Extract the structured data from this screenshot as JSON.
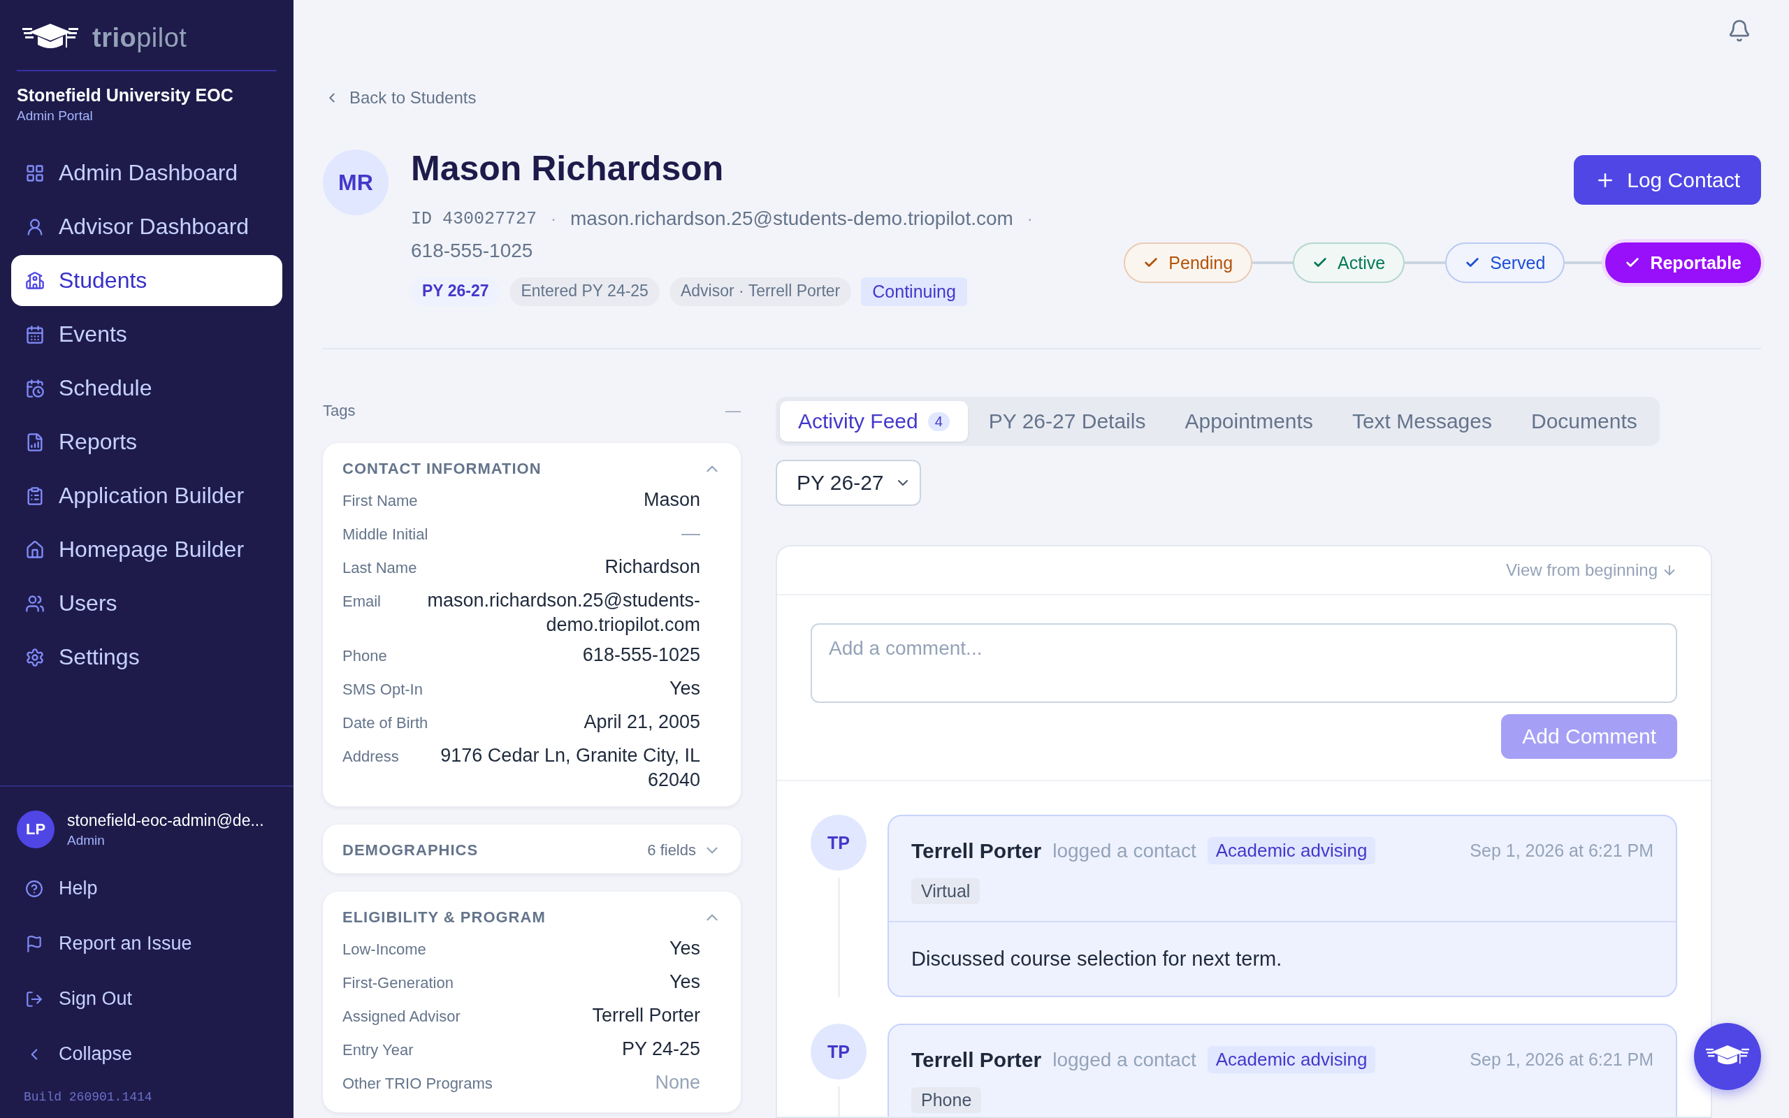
{
  "brand": {
    "wordmark": "**trio**pilot"
  },
  "org": {
    "name": "Stonefield University EOC",
    "subtitle": "Admin Portal"
  },
  "sidebar": {
    "items": [
      {
        "label": "Admin Dashboard",
        "selected": false
      },
      {
        "label": "Advisor Dashboard",
        "selected": false
      },
      {
        "label": "Students",
        "selected": true
      },
      {
        "label": "Events",
        "selected": false
      },
      {
        "label": "Schedule",
        "selected": false
      },
      {
        "label": "Reports",
        "selected": false
      },
      {
        "label": "Application Builder",
        "selected": false
      },
      {
        "label": "Homepage Builder",
        "selected": false
      },
      {
        "label": "Users",
        "selected": false
      },
      {
        "label": "Settings",
        "selected": false
      }
    ]
  },
  "user": {
    "initials": "LP",
    "email": "stonefield-eoc-admin@de...",
    "role": "Admin"
  },
  "sidebar_footer": [
    {
      "label": "Help"
    },
    {
      "label": "Report an Issue"
    },
    {
      "label": "Sign Out"
    },
    {
      "label": "Collapse"
    }
  ],
  "build": "Build 260901.1414",
  "back_link": "Back to Students",
  "student": {
    "initials": "MR",
    "name": "Mason Richardson",
    "id": "ID 430027727",
    "email": "mason.richardson.25@students-demo.triopilot.com",
    "phone": "618-555-1025",
    "separators": [
      "·",
      "·"
    ]
  },
  "chips": [
    {
      "label": "PY 26-27",
      "kind": "program"
    },
    {
      "label": "Entered PY 24-25",
      "kind": "plain"
    },
    {
      "label": "Advisor · Terrell Porter",
      "kind": "plain"
    },
    {
      "label": "Continuing",
      "kind": "status"
    }
  ],
  "log_contact": "Log Contact",
  "status_steps": [
    {
      "label": "Pending",
      "color": "#b45309",
      "checked": true,
      "selected": false
    },
    {
      "label": "Active",
      "color": "#047857",
      "checked": true,
      "selected": false
    },
    {
      "label": "Served",
      "color": "#1d4ed8",
      "checked": true,
      "selected": false
    },
    {
      "label": "Reportable",
      "color": "#9810fa",
      "checked": true,
      "selected": true
    }
  ],
  "tags": {
    "label": "Tags",
    "value": "—"
  },
  "cards": [
    {
      "title": "CONTACT INFORMATION",
      "expanded": true,
      "fields": [
        {
          "label": "First Name",
          "value": "Mason",
          "muted": false
        },
        {
          "label": "Middle Initial",
          "value": "—",
          "muted": true
        },
        {
          "label": "Last Name",
          "value": "Richardson",
          "muted": false
        },
        {
          "label": "Email",
          "value": "mason.richardson.25@students-demo.triopilot.com",
          "muted": false
        },
        {
          "label": "Phone",
          "value": "618-555-1025",
          "muted": false
        },
        {
          "label": "SMS Opt-In",
          "value": "Yes",
          "muted": false
        },
        {
          "label": "Date of Birth",
          "value": "April 21, 2005",
          "muted": false
        },
        {
          "label": "Address",
          "value": "9176 Cedar Ln, Granite City, IL 62040",
          "muted": false
        }
      ]
    },
    {
      "title": "DEMOGRAPHICS",
      "expanded": false,
      "summary": "6 fields"
    },
    {
      "title": "ELIGIBILITY & PROGRAM",
      "expanded": true,
      "fields": [
        {
          "label": "Low-Income",
          "value": "Yes",
          "muted": false
        },
        {
          "label": "First-Generation",
          "value": "Yes",
          "muted": false
        },
        {
          "label": "Assigned Advisor",
          "value": "Terrell Porter",
          "muted": false
        },
        {
          "label": "Entry Year",
          "value": "PY 24-25",
          "muted": false
        },
        {
          "label": "Other TRIO Programs",
          "value": "None",
          "muted": true
        }
      ]
    }
  ],
  "tabs": [
    {
      "label": "Activity Feed",
      "count": "4",
      "selected": true
    },
    {
      "label": "PY 26-27 Details",
      "selected": false
    },
    {
      "label": "Appointments",
      "selected": false
    },
    {
      "label": "Text Messages",
      "selected": false
    },
    {
      "label": "Documents",
      "selected": false
    }
  ],
  "year_select": {
    "value": "PY 26-27"
  },
  "feed": {
    "view_link": "View from beginning",
    "comment_placeholder": "Add a comment...",
    "add_button": {
      "label": "Add Comment",
      "disabled": true
    },
    "entries": [
      {
        "initials": "TP",
        "author": "Terrell Porter",
        "action": "logged a contact",
        "category": "Academic advising",
        "time": "Sep 1, 2026 at 6:21 PM",
        "mode": "Virtual",
        "note": "Discussed course selection for next term."
      },
      {
        "initials": "TP",
        "author": "Terrell Porter",
        "action": "logged a contact",
        "category": "Academic advising",
        "time": "Sep 1, 2026 at 6:21 PM",
        "mode": "Phone"
      }
    ]
  }
}
